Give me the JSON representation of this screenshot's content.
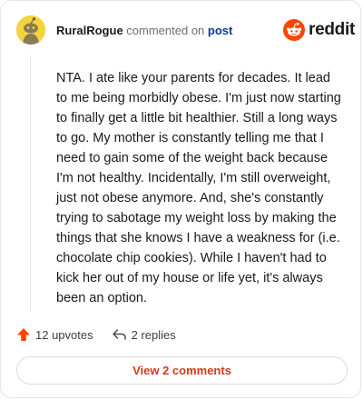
{
  "comment": {
    "username": "RuralRogue",
    "action_text": "commented on",
    "post_link": "post",
    "body": "NTA. I ate like your parents for decades. It lead to me being morbidly obese. I'm just now starting to finally get a little bit healthier. Still a long ways to go. My mother is constantly telling me that I need to gain some of the weight back because I'm not healthy. Incidentally, I'm still overweight, just not obese anymore. And, she's constantly trying to sabotage my weight loss by making the things that she knows I have a weakness for (i.e. chocolate chip cookies). While I haven't had to kick her out of my house or life yet, it's always been an option."
  },
  "brand": {
    "name": "reddit",
    "icon": "reddit-snoo-icon",
    "color": "#ff4500"
  },
  "footer": {
    "upvotes_label": "12 upvotes",
    "upvote_icon": "upvote-arrow-icon",
    "replies_label": "2 replies",
    "reply_icon": "reply-arrow-icon"
  },
  "view_comments_label": "View 2 comments",
  "colors": {
    "avatar_bg": "#f3d43c",
    "upvote": "#ff4500",
    "view_button_text": "#d23c1c",
    "post_link": "#0a3b8f"
  }
}
